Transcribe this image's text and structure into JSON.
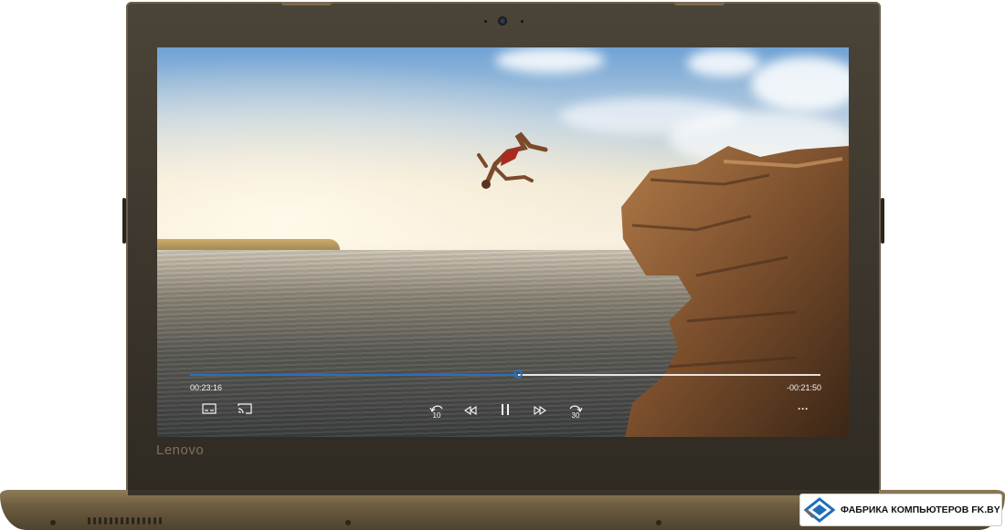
{
  "device": {
    "brand": "Lenovo"
  },
  "player": {
    "time_elapsed": "00:23:16",
    "time_remaining": "-00:21:50",
    "progress_fraction": 0.52,
    "accent_color": "#2b6fc2",
    "controls": {
      "skip_back_seconds": "10",
      "skip_forward_seconds": "30",
      "more": "···"
    },
    "icons": [
      "subtitles-icon",
      "cast-icon",
      "replay-10-icon",
      "rewind-icon",
      "pause-icon",
      "fast-forward-icon",
      "forward-30-icon",
      "more-options-icon"
    ]
  },
  "watermark": {
    "text": "ФАБРИКА КОМПЬЮТЕРОВ FK.BY"
  }
}
